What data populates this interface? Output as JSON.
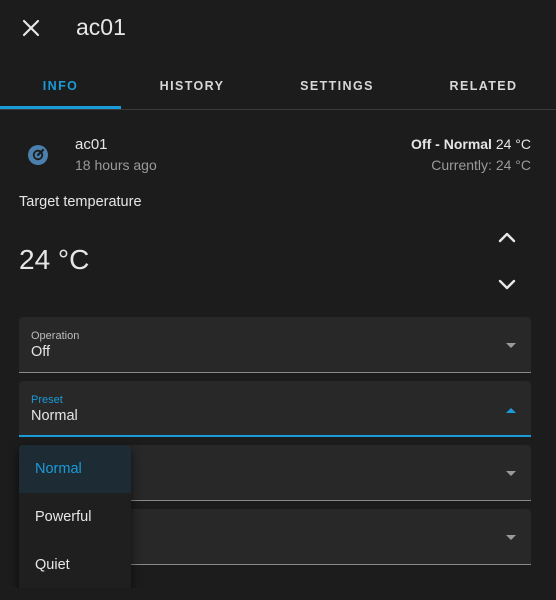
{
  "dialog": {
    "title": "ac01"
  },
  "tabs": [
    {
      "label": "INFO",
      "active": true
    },
    {
      "label": "HISTORY",
      "active": false
    },
    {
      "label": "SETTINGS",
      "active": false
    },
    {
      "label": "RELATED",
      "active": false
    }
  ],
  "entity": {
    "name": "ac01",
    "last_changed": "18 hours ago",
    "state_bold": "Off - Normal",
    "state_temp": "24 °C",
    "current": "Currently: 24 °C",
    "icon": "thermostat-icon"
  },
  "target": {
    "label": "Target temperature",
    "value": "24 °C"
  },
  "selects": {
    "operation": {
      "label": "Operation",
      "value": "Off"
    },
    "preset": {
      "label": "Preset",
      "value": "Normal"
    }
  },
  "preset_menu": {
    "options": [
      "Normal",
      "Powerful",
      "Quiet"
    ],
    "selected": "Normal"
  },
  "colors": {
    "accent": "#1a9bd7",
    "background": "#1c1c1c",
    "field": "#282828",
    "icon": "#4a7fae"
  }
}
